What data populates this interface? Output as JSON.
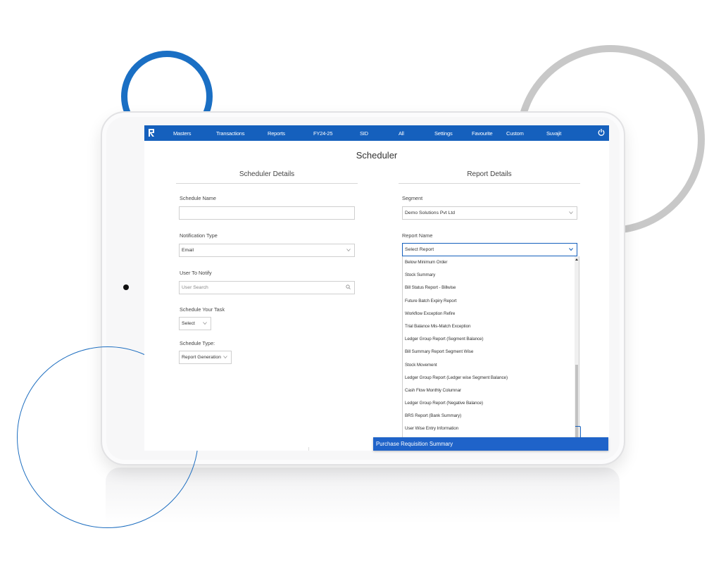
{
  "navbar": {
    "items": [
      "Masters",
      "Transactions",
      "Reports",
      "FY24-25",
      "SID",
      "All",
      "Settings",
      "Favourite",
      "Custom",
      "Suvajit"
    ],
    "accent": "#1560bd",
    "logo_icon": "app-logo-icon",
    "power_icon": "power-icon"
  },
  "page": {
    "title": "Scheduler"
  },
  "scheduler_details": {
    "title": "Scheduler Details",
    "schedule_name_label": "Schedule Name",
    "schedule_name_value": "",
    "notification_type_label": "Notification Type",
    "notification_type_value": "Email",
    "user_to_notify_label": "User To Notify",
    "user_search_placeholder": "User Search",
    "schedule_task_label": "Schedule Your Task",
    "schedule_task_value": "Select",
    "schedule_type_label": "Schedule Type:",
    "schedule_type_value": "Report Generation"
  },
  "report_details": {
    "title": "Report Details",
    "segment_label": "Segment",
    "segment_value": "Demo Solutions Pvt Ltd",
    "report_name_label": "Report Name",
    "report_name_value": "Select Report",
    "report_options": [
      "Below Minimum Order",
      "Stock Summary",
      "Bill Status Report - Billwise",
      "Future Batch Expiry Report",
      "Workflow Exception Refire",
      "Trial Balance Mis-Match Exception",
      "Ledger Group Report (Segment Balance)",
      "Bill Summary Report Segment Wise",
      "Stock Movement",
      "Ledger Group Report (Ledger wise Segment Balance)",
      "Cash Flow Monthly Columnar",
      "Ledger Group Report (Negative Balance)",
      "BRS Report (Bank Summary)",
      "User Wise Entry Information"
    ],
    "highlighted_option": "Purchase Requisition Summary",
    "highlight_color": "#1f63c9"
  }
}
